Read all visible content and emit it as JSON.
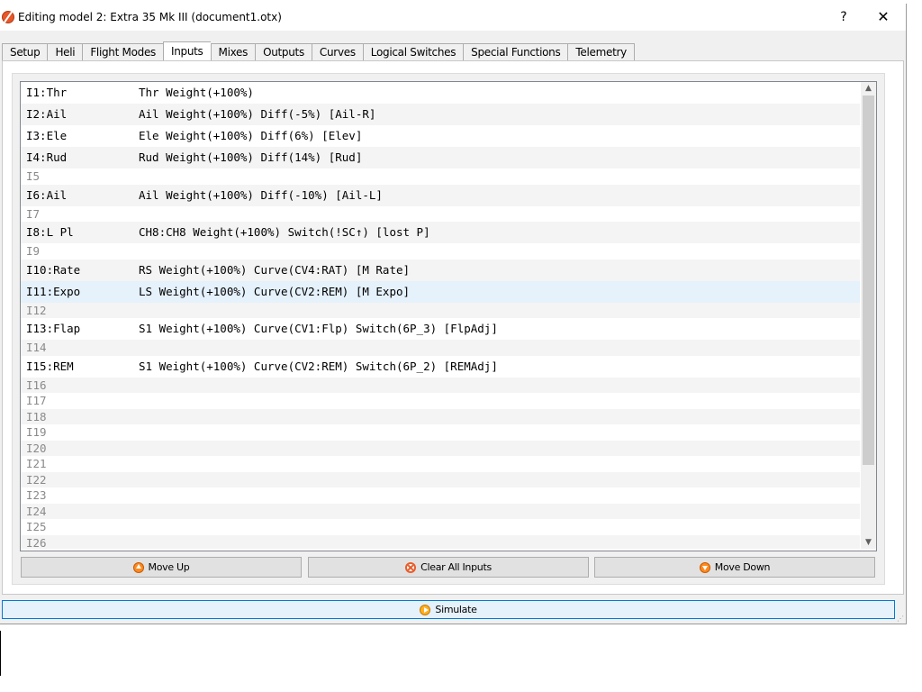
{
  "window": {
    "title": "Editing model 2: Extra 35 Mk III  (document1.otx)",
    "help": "?",
    "close": "✕"
  },
  "tabs": [
    {
      "label": "Setup"
    },
    {
      "label": "Heli"
    },
    {
      "label": "Flight Modes"
    },
    {
      "label": "Inputs",
      "active": true
    },
    {
      "label": "Mixes"
    },
    {
      "label": "Outputs"
    },
    {
      "label": "Curves"
    },
    {
      "label": "Logical Switches"
    },
    {
      "label": "Special Functions"
    },
    {
      "label": "Telemetry"
    }
  ],
  "inputs": [
    {
      "id": "I1:Thr",
      "desc": "Thr Weight(+100%)"
    },
    {
      "id": "I2:Ail",
      "desc": "Ail Weight(+100%) Diff(-5%) [Ail-R]"
    },
    {
      "id": "I3:Ele",
      "desc": "Ele Weight(+100%) Diff(6%) [Elev]"
    },
    {
      "id": "I4:Rud",
      "desc": "Rud Weight(+100%) Diff(14%) [Rud]"
    },
    {
      "id": "I5",
      "desc": ""
    },
    {
      "id": "I6:Ail",
      "desc": "Ail Weight(+100%) Diff(-10%) [Ail-L]"
    },
    {
      "id": "I7",
      "desc": ""
    },
    {
      "id": "I8:L Pl",
      "desc": "CH8:CH8 Weight(+100%) Switch(!SC↑) [lost P]"
    },
    {
      "id": "I9",
      "desc": ""
    },
    {
      "id": "I10:Rate",
      "desc": "RS Weight(+100%) Curve(CV4:RAT) [M Rate]"
    },
    {
      "id": "I11:Expo",
      "desc": "LS Weight(+100%) Curve(CV2:REM) [M Expo]"
    },
    {
      "id": "I12",
      "desc": ""
    },
    {
      "id": "I13:Flap",
      "desc": "S1 Weight(+100%) Curve(CV1:Flp) Switch(6P_3) [FlpAdj]"
    },
    {
      "id": "I14",
      "desc": ""
    },
    {
      "id": "I15:REM",
      "desc": "S1 Weight(+100%) Curve(CV2:REM) Switch(6P_2) [REMAdj]"
    },
    {
      "id": "I16",
      "desc": ""
    },
    {
      "id": "I17",
      "desc": ""
    },
    {
      "id": "I18",
      "desc": ""
    },
    {
      "id": "I19",
      "desc": ""
    },
    {
      "id": "I20",
      "desc": ""
    },
    {
      "id": "I21",
      "desc": ""
    },
    {
      "id": "I22",
      "desc": ""
    },
    {
      "id": "I23",
      "desc": ""
    },
    {
      "id": "I24",
      "desc": ""
    },
    {
      "id": "I25",
      "desc": ""
    },
    {
      "id": "I26",
      "desc": ""
    }
  ],
  "selected_row": 10,
  "buttons": {
    "move_up": "Move Up",
    "clear_all": "Clear All Inputs",
    "move_down": "Move Down"
  },
  "simulate": "Simulate",
  "icons": {
    "app": "companion-icon",
    "move_up": "arrow-up-circle-icon",
    "clear": "x-circle-icon",
    "move_down": "arrow-down-circle-icon",
    "simulate": "play-circle-icon"
  }
}
